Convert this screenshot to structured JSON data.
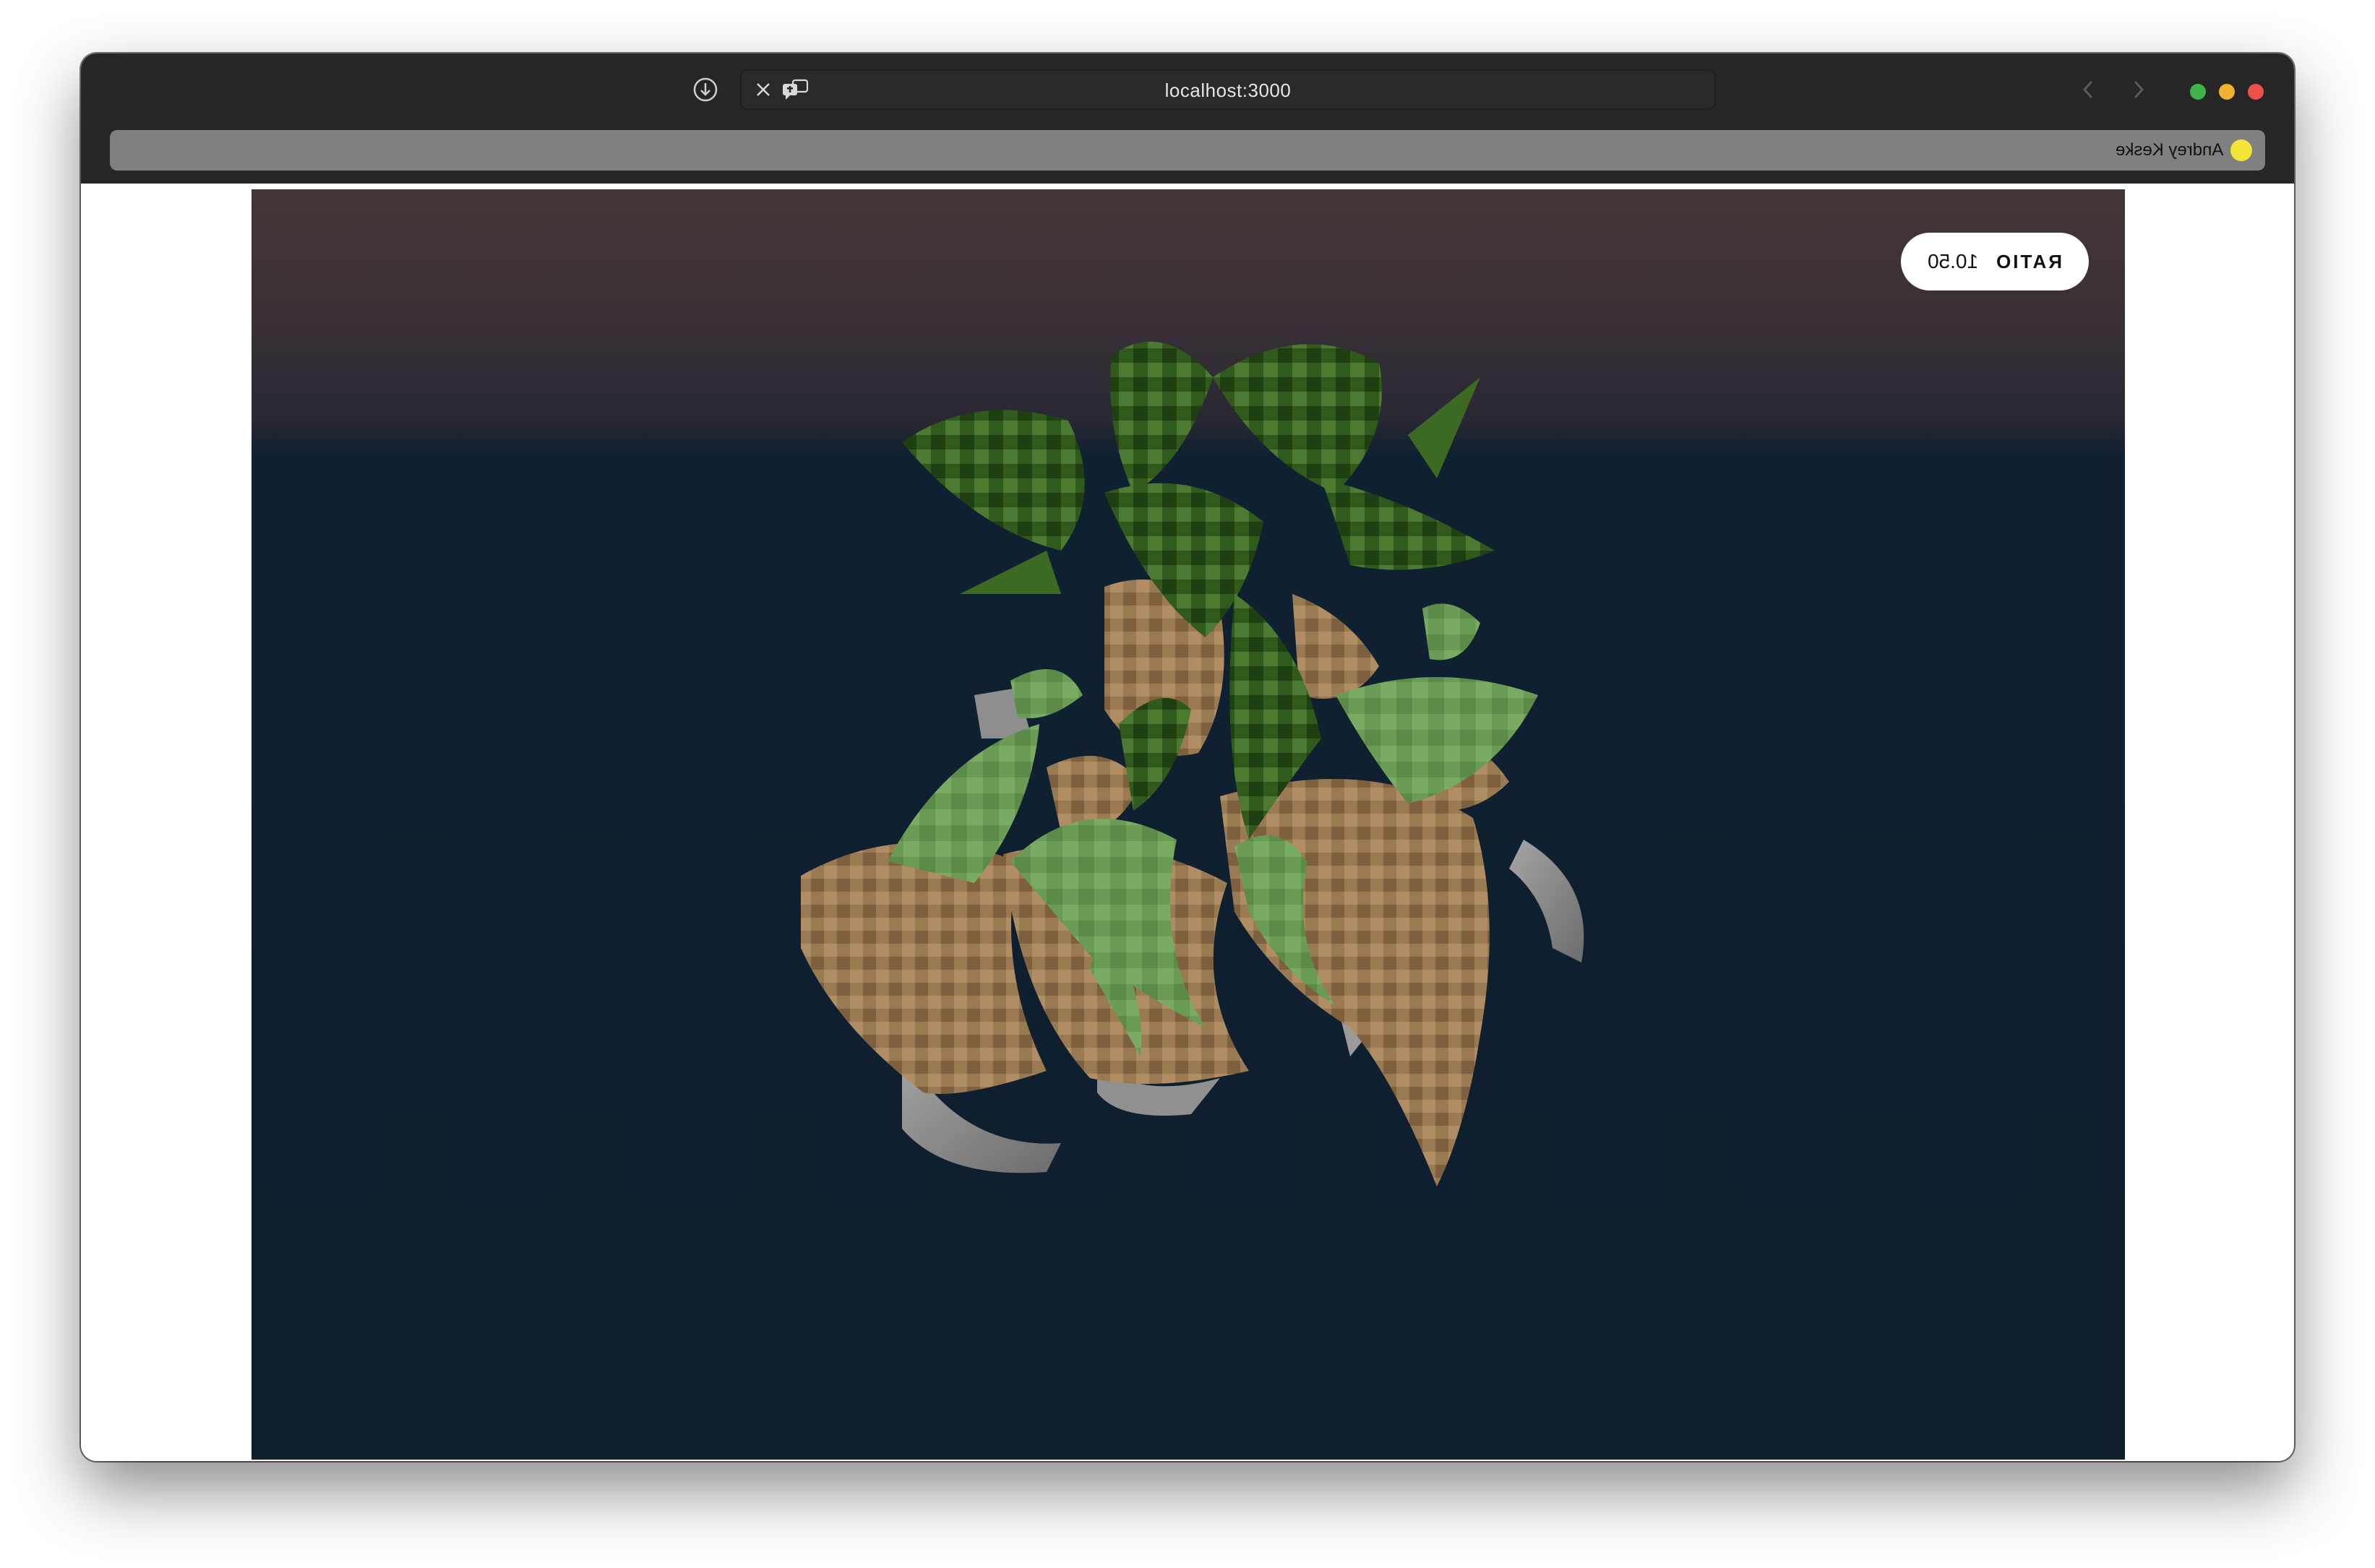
{
  "browser": {
    "url": "localhost:3000",
    "profile_name": "Andrey Keske",
    "profile_color": "#f3e437"
  },
  "overlay": {
    "ratio_label": "RATIO",
    "ratio_value": "10.50"
  },
  "colors": {
    "sky_top": "#443636",
    "background": "#0e1f2e",
    "leaf_dark": "#2f5a1c",
    "leaf_light": "#6b9c55",
    "bark": "#9b7a52",
    "stone": "#8c8c8c"
  },
  "icons": {
    "download": "download-icon",
    "close": "close-icon",
    "translate": "translate-icon",
    "back": "chevron-left-icon",
    "forward": "chevron-right-icon"
  }
}
